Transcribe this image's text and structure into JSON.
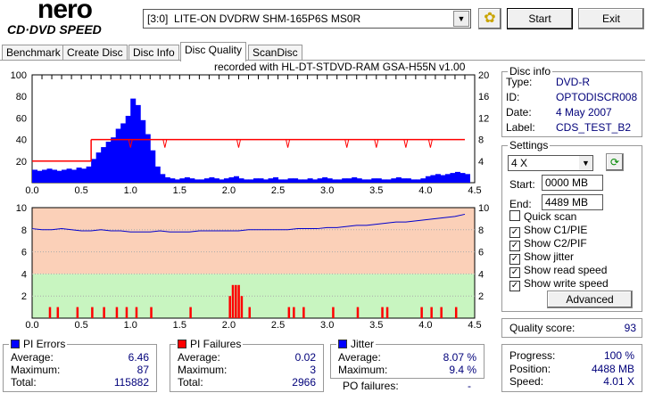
{
  "app": {
    "logo_top": "nero",
    "logo_bottom": "CD·DVD SPEED"
  },
  "toolbar": {
    "drive": "[3:0]  LITE-ON DVDRW SHM-165P6S MS0R",
    "start": "Start",
    "exit": "Exit"
  },
  "tabs": [
    "Benchmark",
    "Create Disc",
    "Disc Info",
    "Disc Quality",
    "ScanDisc"
  ],
  "chart_title": "recorded with HL-DT-STDVD-RAM GSA-H55N v1.00",
  "disc_info": {
    "title": "Disc info",
    "rows": [
      [
        "Type:",
        "DVD-R"
      ],
      [
        "ID:",
        "OPTODISCR008"
      ],
      [
        "Date:",
        "4 May 2007"
      ],
      [
        "Label:",
        "CDS_TEST_B2"
      ]
    ]
  },
  "settings": {
    "title": "Settings",
    "speed": "4 X",
    "start_label": "Start:",
    "start": "0000 MB",
    "end_label": "End:",
    "end": "4489 MB",
    "checks": [
      {
        "label": "Quick scan",
        "checked": false
      },
      {
        "label": "Show C1/PIE",
        "checked": true
      },
      {
        "label": "Show C2/PIF",
        "checked": true
      },
      {
        "label": "Show jitter",
        "checked": true
      },
      {
        "label": "Show read speed",
        "checked": true
      },
      {
        "label": "Show write speed",
        "checked": true
      }
    ],
    "advanced": "Advanced"
  },
  "quality": {
    "label": "Quality score:",
    "value": "93"
  },
  "progress": {
    "rows": [
      [
        "Progress:",
        "100 %"
      ],
      [
        "Position:",
        "4488 MB"
      ],
      [
        "Speed:",
        "4.01 X"
      ]
    ]
  },
  "pi_errors": {
    "title": "PI Errors",
    "color": "#0000ff",
    "rows": [
      [
        "Average:",
        "6.46"
      ],
      [
        "Maximum:",
        "87"
      ],
      [
        "Total:",
        "115882"
      ]
    ]
  },
  "pi_failures": {
    "title": "PI Failures",
    "color": "#ff0000",
    "rows": [
      [
        "Average:",
        "0.02"
      ],
      [
        "Maximum:",
        "3"
      ],
      [
        "Total:",
        "2966"
      ]
    ]
  },
  "jitter": {
    "title": "Jitter",
    "color": "#0000ff",
    "rows": [
      [
        "Average:",
        "8.07 %"
      ],
      [
        "Maximum:",
        "9.4 %"
      ]
    ]
  },
  "po_failures": {
    "label": "PO failures:",
    "value": "-"
  },
  "chart_data": [
    {
      "type": "bar",
      "name": "PI errors + read speed",
      "xlim": [
        0,
        4.5
      ],
      "ylim": [
        0,
        100
      ],
      "y2lim": [
        0,
        20
      ],
      "xticks": [
        "0.0",
        "0.5",
        "1.0",
        "1.5",
        "2.0",
        "2.5",
        "3.0",
        "3.5",
        "4.0",
        "4.5"
      ],
      "yticks": [
        "20",
        "40",
        "60",
        "80",
        "100"
      ],
      "y2ticks": [
        "4",
        "8",
        "12",
        "16",
        "20"
      ],
      "x_step": 0.05,
      "pie": [
        12,
        11,
        12,
        13,
        12,
        11,
        12,
        13,
        12,
        14,
        13,
        15,
        22,
        28,
        33,
        38,
        42,
        50,
        55,
        62,
        78,
        72,
        58,
        45,
        30,
        15,
        8,
        5,
        4,
        3,
        4,
        5,
        4,
        3,
        3,
        4,
        5,
        4,
        3,
        4,
        5,
        6,
        4,
        3,
        3,
        4,
        4,
        3,
        4,
        5,
        3,
        3,
        4,
        4,
        3,
        3,
        4,
        3,
        4,
        5,
        4,
        3,
        3,
        4,
        4,
        5,
        4,
        3,
        3,
        4,
        4,
        3,
        3,
        4,
        5,
        4,
        4,
        3,
        3,
        4,
        6,
        7,
        8,
        7,
        8,
        9,
        10,
        9,
        8
      ],
      "speed": {
        "segments": [
          [
            0,
            0.6,
            4
          ],
          [
            0.6,
            4.4,
            8
          ]
        ],
        "dips": [
          1.0,
          1.35,
          2.1,
          2.6,
          3.2,
          3.5,
          3.8,
          4.05
        ]
      }
    },
    {
      "type": "bar",
      "name": "PI failures + jitter",
      "xlim": [
        0,
        4.5
      ],
      "ylim": [
        0,
        10
      ],
      "xticks": [
        "0.0",
        "0.5",
        "1.0",
        "1.5",
        "2.0",
        "2.5",
        "3.0",
        "3.5",
        "4.0",
        "4.5"
      ],
      "yticks": [
        "2",
        "4",
        "6",
        "8",
        "10"
      ],
      "pif": [
        [
          0.17,
          1
        ],
        [
          0.25,
          1
        ],
        [
          0.45,
          1
        ],
        [
          0.6,
          1
        ],
        [
          0.72,
          1
        ],
        [
          0.85,
          1
        ],
        [
          0.95,
          1
        ],
        [
          1.05,
          1
        ],
        [
          1.2,
          1
        ],
        [
          1.6,
          1
        ],
        [
          2.0,
          2
        ],
        [
          2.03,
          3
        ],
        [
          2.06,
          3
        ],
        [
          2.09,
          3
        ],
        [
          2.12,
          2
        ],
        [
          2.2,
          1
        ],
        [
          2.6,
          1
        ],
        [
          2.65,
          1
        ],
        [
          2.75,
          1
        ],
        [
          3.05,
          1
        ],
        [
          3.3,
          1
        ],
        [
          3.55,
          1
        ],
        [
          3.6,
          1
        ],
        [
          3.95,
          1
        ],
        [
          4.05,
          1
        ],
        [
          4.15,
          1
        ],
        [
          4.3,
          1
        ]
      ],
      "jitter_step": 0.1,
      "jitter": [
        8.1,
        8.0,
        8.0,
        8.1,
        8.0,
        7.9,
        7.9,
        8.0,
        7.9,
        7.9,
        7.8,
        7.8,
        7.8,
        7.9,
        7.8,
        7.8,
        7.8,
        7.9,
        7.9,
        7.9,
        7.9,
        7.9,
        8.0,
        8.0,
        8.0,
        8.0,
        8.0,
        8.1,
        8.1,
        8.1,
        8.2,
        8.2,
        8.3,
        8.4,
        8.4,
        8.5,
        8.6,
        8.7,
        8.7,
        8.8,
        8.9,
        9.0,
        9.1,
        9.2,
        9.4
      ]
    }
  ]
}
